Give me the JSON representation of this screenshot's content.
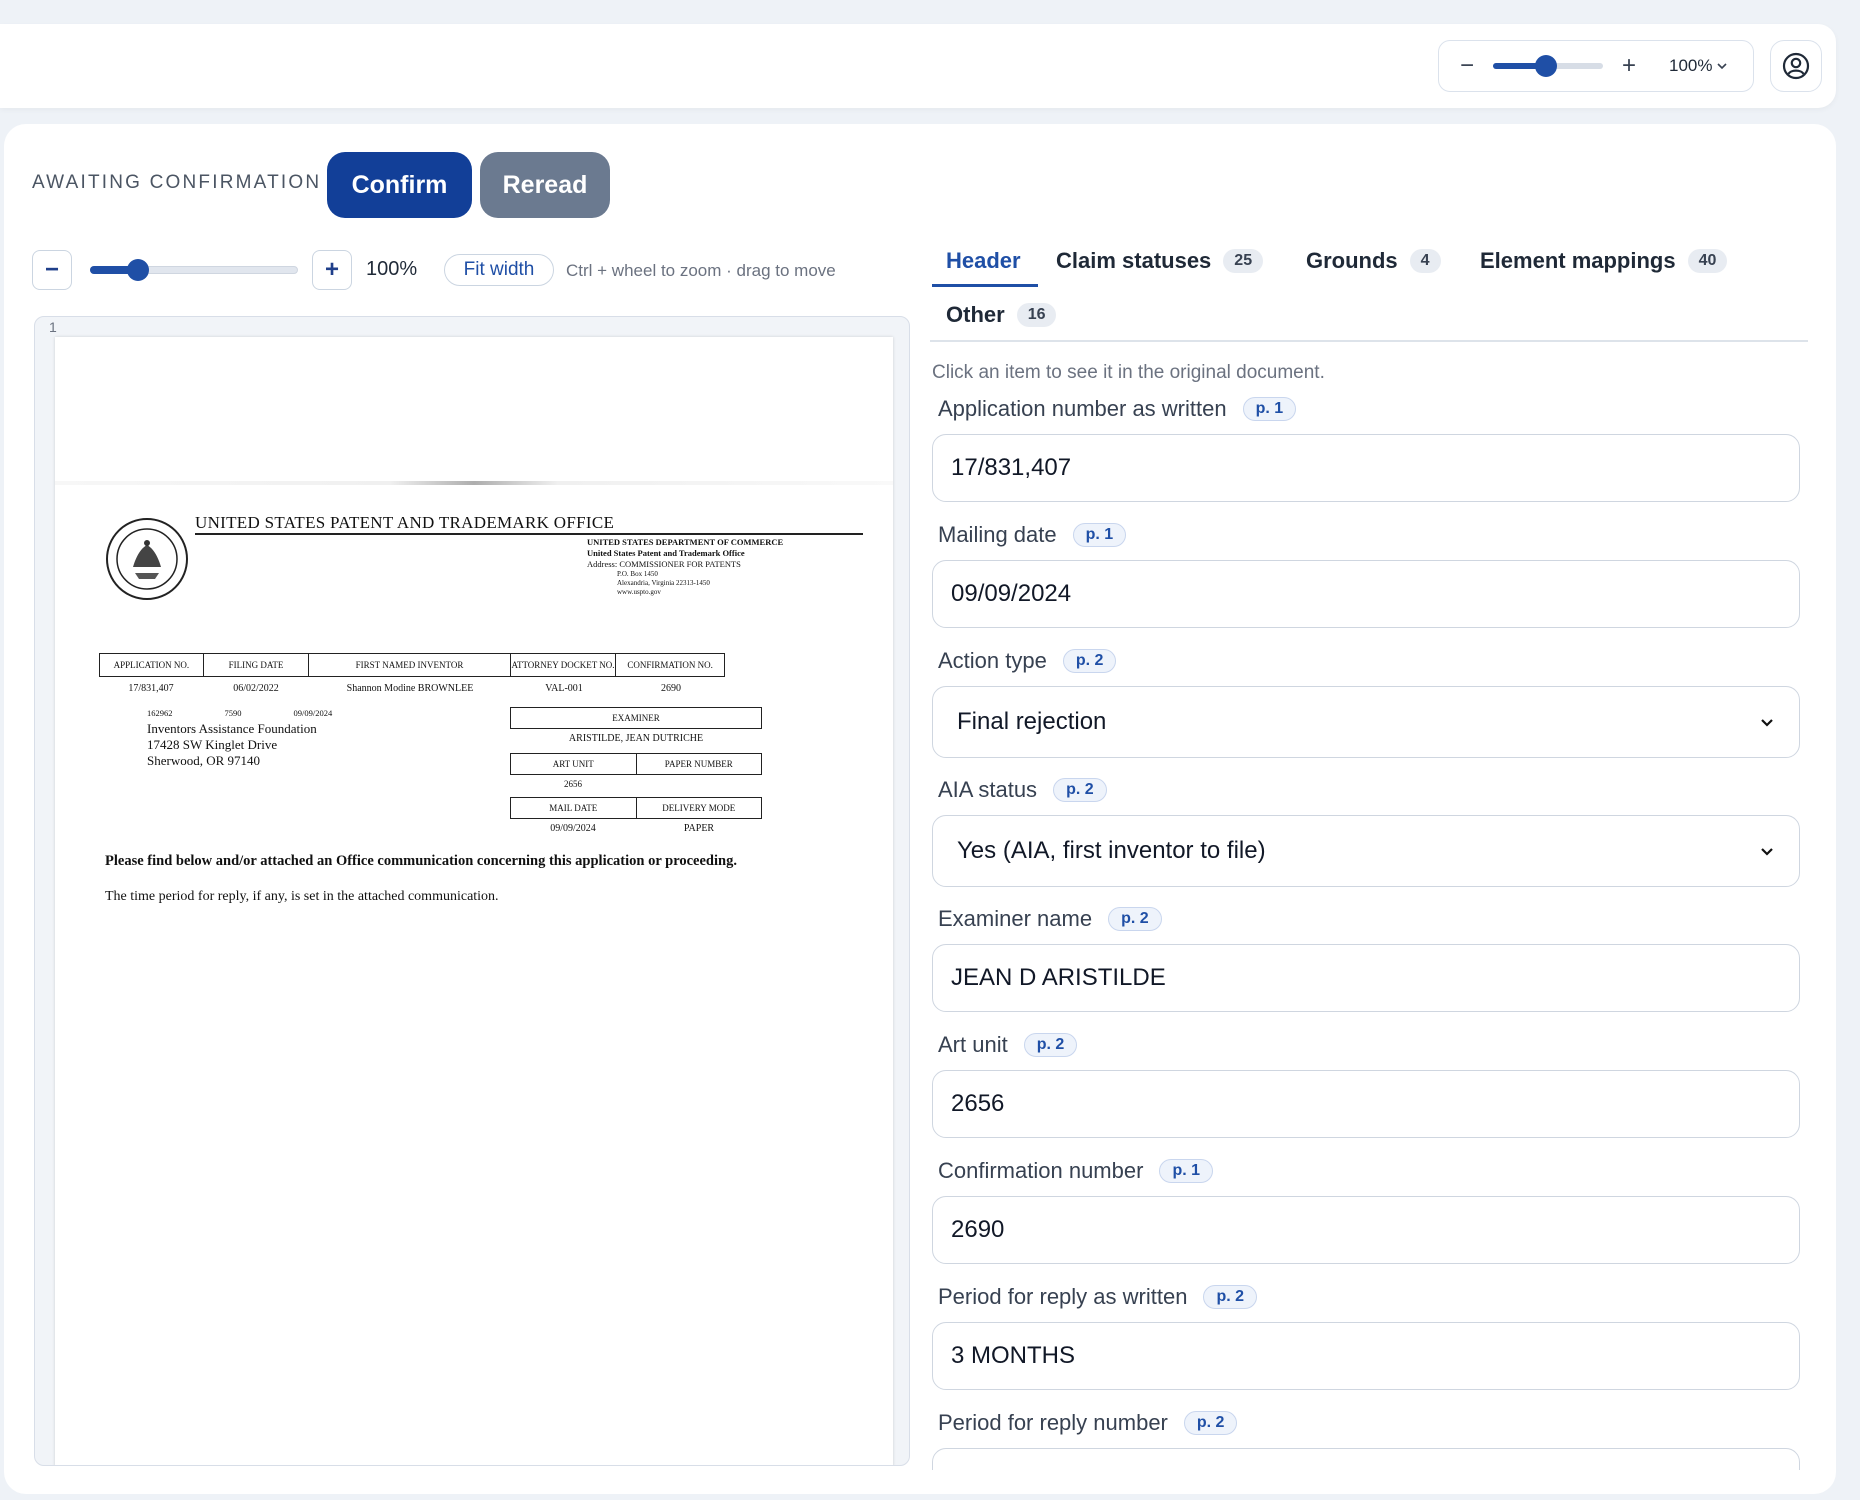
{
  "topbar": {
    "zoom_minus": "−",
    "zoom_plus": "+",
    "zoom_level": "100%",
    "zoom_slider_value": 0.48,
    "account_icon": "user-circle-icon"
  },
  "review": {
    "status": "AWAITING CONFIRMATION",
    "confirm_label": "Confirm",
    "reread_label": "Reread"
  },
  "viewer": {
    "zoom_out": "−",
    "zoom_in": "+",
    "slider_value": 0.23,
    "zoom_level": "100%",
    "fit_width_label": "Fit width",
    "hint": "Ctrl + wheel to zoom · drag to move",
    "page_number": "1"
  },
  "document": {
    "office_title": "UNITED STATES PATENT AND TRADEMARK OFFICE",
    "dept_line1": "UNITED STATES DEPARTMENT OF COMMERCE",
    "dept_line2": "United States Patent and Trademark Office",
    "dept_line3": "Address: COMMISSIONER FOR PATENTS",
    "dept_line4": "P.O. Box 1450",
    "dept_line5": "Alexandria, Virginia 22313-1450",
    "dept_line6": "www.uspto.gov",
    "columns": [
      "APPLICATION NO.",
      "FILING DATE",
      "FIRST NAMED INVENTOR",
      "ATTORNEY DOCKET NO.",
      "CONFIRMATION NO."
    ],
    "values": [
      "17/831,407",
      "06/02/2022",
      "Shannon Modine BROWNLEE",
      "VAL-001",
      "2690"
    ],
    "addr_codes": [
      "162962",
      "7590",
      "09/09/2024"
    ],
    "addr_line1": "Inventors Assistance Foundation",
    "addr_line2": "17428 SW Kinglet Drive",
    "addr_line3": "Sherwood, OR 97140",
    "examiner_label": "EXAMINER",
    "examiner_value": "ARISTILDE, JEAN DUTRICHE",
    "art_unit_label": "ART UNIT",
    "paper_number_label": "PAPER NUMBER",
    "art_unit_value": "2656",
    "mail_date_label": "MAIL DATE",
    "delivery_mode_label": "DELIVERY MODE",
    "mail_date_value": "09/09/2024",
    "delivery_mode_value": "PAPER",
    "notice1": "Please find below and/or attached an Office communication concerning this application or proceeding.",
    "notice2": "The time period for reply, if any, is set in the attached communication."
  },
  "tabs": [
    {
      "label": "Header",
      "count": ""
    },
    {
      "label": "Claim statuses",
      "count": "25"
    },
    {
      "label": "Grounds",
      "count": "4"
    },
    {
      "label": "Element mappings",
      "count": "40"
    },
    {
      "label": "Other",
      "count": "16"
    }
  ],
  "form_hint": "Click an item to see it in the original document.",
  "fields": [
    {
      "label": "Application number as written",
      "page": "p. 1",
      "value": "17/831,407",
      "kind": "input"
    },
    {
      "label": "Mailing date",
      "page": "p. 1",
      "value": "09/09/2024",
      "kind": "input"
    },
    {
      "label": "Action type",
      "page": "p. 2",
      "value": "Final rejection",
      "kind": "select"
    },
    {
      "label": "AIA status",
      "page": "p. 2",
      "value": "Yes (AIA, first inventor to file)",
      "kind": "select"
    },
    {
      "label": "Examiner name",
      "page": "p. 2",
      "value": "JEAN D ARISTILDE",
      "kind": "input"
    },
    {
      "label": "Art unit",
      "page": "p. 2",
      "value": "2656",
      "kind": "input"
    },
    {
      "label": "Confirmation number",
      "page": "p. 1",
      "value": "2690",
      "kind": "input"
    },
    {
      "label": "Period for reply as written",
      "page": "p. 2",
      "value": "3 MONTHS",
      "kind": "input"
    },
    {
      "label": "Period for reply number",
      "page": "p. 2",
      "value": "",
      "kind": "input"
    }
  ]
}
